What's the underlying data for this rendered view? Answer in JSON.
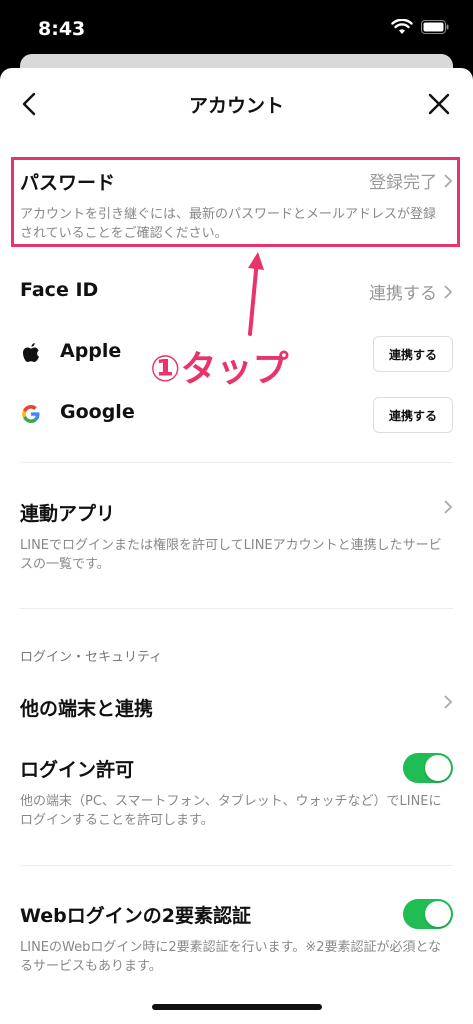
{
  "status_bar": {
    "time": "8:43"
  },
  "header": {
    "title": "アカウント"
  },
  "password": {
    "title": "パスワード",
    "status": "登録完了",
    "description": "アカウントを引き継ぐには、最新のパスワードとメールアドレスが登録されていることをご確認ください。"
  },
  "face_id": {
    "title": "Face ID",
    "action": "連携する"
  },
  "apple": {
    "title": "Apple",
    "button": "連携する"
  },
  "google": {
    "title": "Google",
    "button": "連携する"
  },
  "linked_apps": {
    "title": "連動アプリ",
    "description": "LINEでログインまたは権限を許可してLINEアカウントと連携したサービスの一覧です。"
  },
  "security_section": {
    "label": "ログイン・セキュリティ"
  },
  "other_devices": {
    "title": "他の端末と連携"
  },
  "login_permission": {
    "title": "ログイン許可",
    "description": "他の端末（PC、スマートフォン、タブレット、ウォッチなど）でLINEにログインすることを許可します。",
    "enabled": true
  },
  "web_2fa": {
    "title": "Webログインの2要素認証",
    "description": "LINEのWebログイン時に2要素認証を行います。※2要素認証が必須となるサービスもあります。",
    "enabled": true
  },
  "annotation": {
    "text": "①タップ"
  },
  "colors": {
    "accent": "#e8336b",
    "toggle_on": "#1fbd54"
  }
}
